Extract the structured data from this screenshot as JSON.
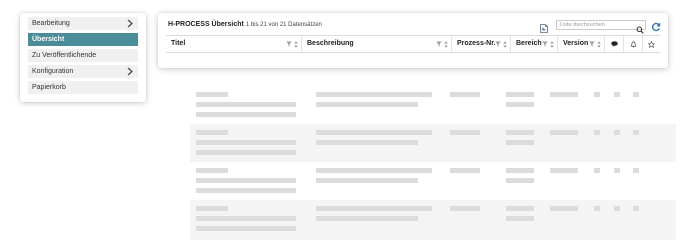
{
  "sidebar": {
    "items": [
      {
        "label": "Bearbeitung",
        "active": false,
        "has_submenu": true
      },
      {
        "label": "Übersicht",
        "active": true,
        "has_submenu": false
      },
      {
        "label": "Zu Veröffentlichende",
        "active": false,
        "has_submenu": false
      },
      {
        "label": "Konfiguration",
        "active": false,
        "has_submenu": true
      },
      {
        "label": "Papierkorb",
        "active": false,
        "has_submenu": false
      }
    ]
  },
  "panel": {
    "title": "H-PROCESS Übersicht",
    "record_info": "1 bis 21 von 21 Datensätzen",
    "search_placeholder": "Liste durchsuchen",
    "export_icon": "pdf-export-icon",
    "search_icon": "search-icon",
    "refresh_icon": "refresh-icon"
  },
  "table": {
    "columns": [
      {
        "label": "Titel",
        "filter": true,
        "sort": true
      },
      {
        "label": "Beschreibung",
        "filter": true,
        "sort": true
      },
      {
        "label": "Prozess-Nr.",
        "filter": true,
        "sort": true
      },
      {
        "label": "Bereich",
        "filter": true,
        "sort": true
      },
      {
        "label": "Version",
        "filter": true,
        "sort": true
      },
      {
        "icon": "comment-icon"
      },
      {
        "icon": "bell-icon"
      },
      {
        "icon": "star-icon"
      }
    ]
  },
  "colors": {
    "accent": "#4a8c98",
    "refresh": "#2a6db8",
    "sidebar_item_bg": "#f0f0f0",
    "skeleton": "#dcdcdc",
    "row_alt": "#f4f4f4"
  }
}
